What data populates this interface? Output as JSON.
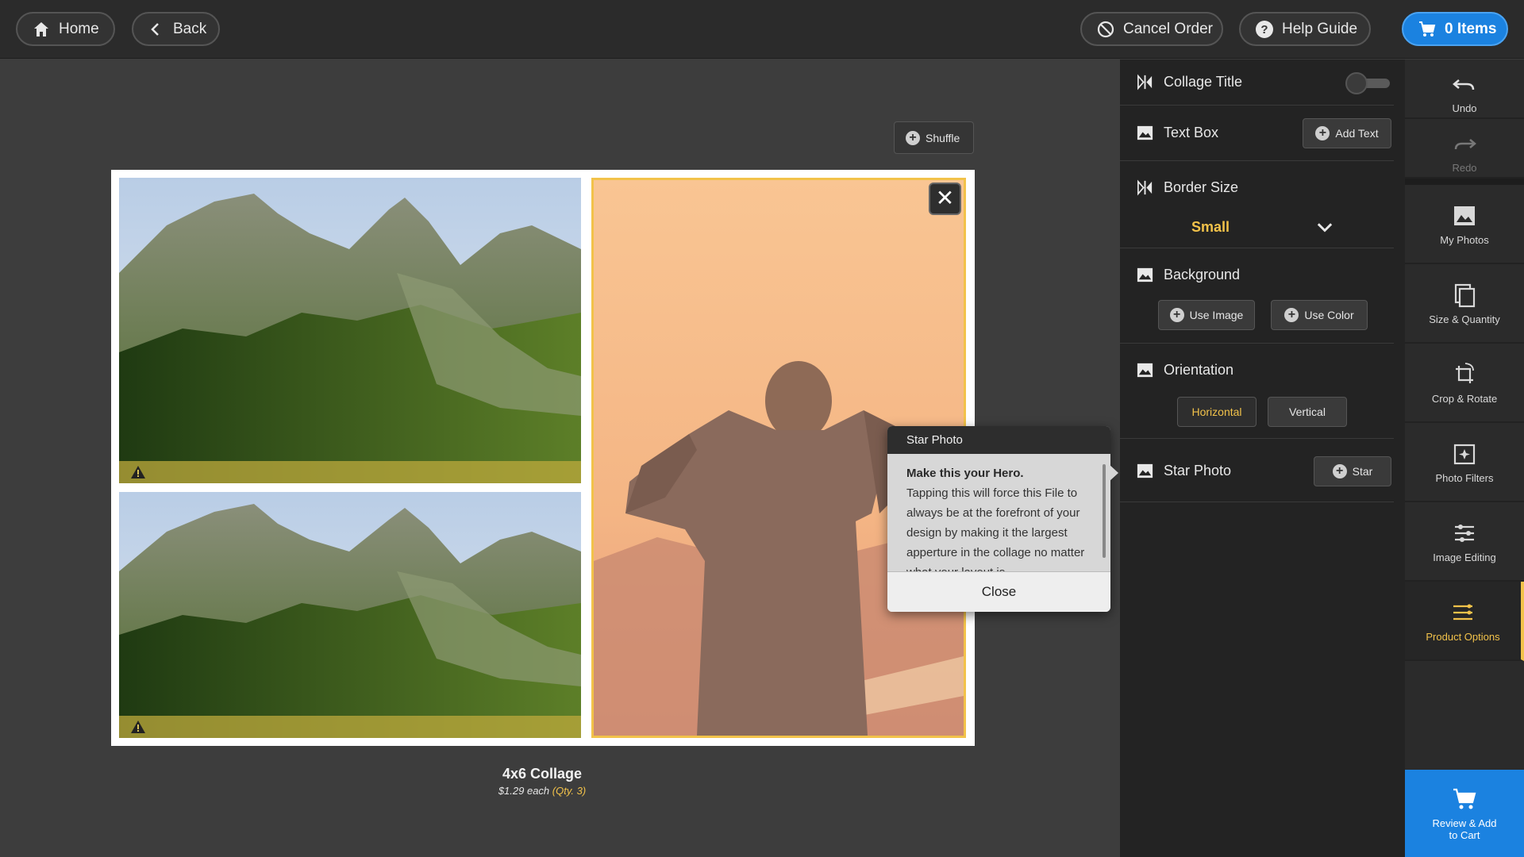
{
  "topbar": {
    "home_label": "Home",
    "back_label": "Back",
    "cancel_label": "Cancel Order",
    "help_label": "Help Guide",
    "cart_label": "0 Items"
  },
  "canvas": {
    "shuffle_label": "Shuffle",
    "close_symbol": "✕",
    "caption_title": "4x6 Collage",
    "caption_price": "$1.29 each",
    "caption_qty": "(Qty. 3)"
  },
  "tooltip": {
    "title": "Star Photo",
    "heading": "Make this your Hero.",
    "body": "Tapping this will force this File to always be at the forefront of your design by making it the largest apperture in the collage no matter what your layout is.",
    "close_label": "Close"
  },
  "panel": {
    "collage_title": {
      "label": "Collage Title",
      "enabled": false
    },
    "text_box": {
      "label": "Text Box",
      "button": "Add Text"
    },
    "border_size": {
      "label": "Border Size",
      "value": "Small"
    },
    "background": {
      "label": "Background",
      "image_button": "Use Image",
      "color_button": "Use Color"
    },
    "orientation": {
      "label": "Orientation",
      "options": [
        "Horizontal",
        "Vertical"
      ],
      "selected": "Horizontal"
    },
    "star_photo": {
      "label": "Star Photo",
      "button": "Star"
    }
  },
  "tools": {
    "undo": "Undo",
    "redo": "Redo",
    "my_photos": "My Photos",
    "size_quantity": "Size & Quantity",
    "crop_rotate": "Crop & Rotate",
    "photo_filters": "Photo Filters",
    "image_editing": "Image Editing",
    "product_options": "Product Options",
    "review_line1": "Review & Add",
    "review_line2": "to Cart"
  },
  "colors": {
    "accent": "#f2c24a",
    "primary_blue": "#1b82e0"
  }
}
